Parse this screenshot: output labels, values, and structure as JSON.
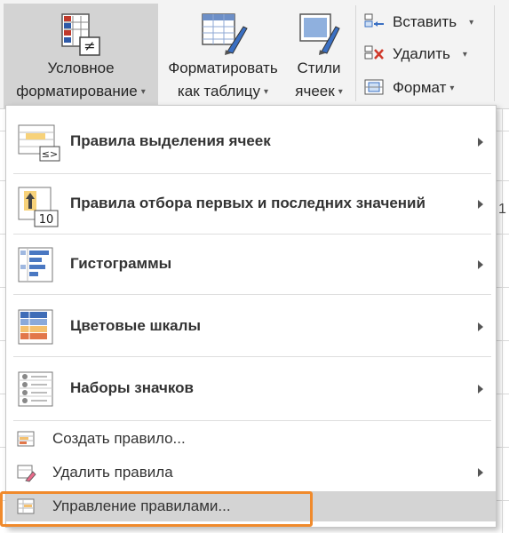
{
  "ribbon": {
    "conditional_formatting": {
      "line1": "Условное",
      "line2": "форматирование"
    },
    "format_as_table": {
      "line1": "Форматировать",
      "line2": "как таблицу"
    },
    "cell_styles": {
      "line1": "Стили",
      "line2": "ячеек"
    },
    "cells_group": {
      "insert": "Вставить",
      "delete": "Удалить",
      "format": "Формат"
    }
  },
  "menu": {
    "big_items": [
      {
        "label": "Правила выделения ячеек",
        "icon": "highlight-cells-rules-icon",
        "has_submenu": true
      },
      {
        "label": "Правила отбора первых и последних значений",
        "icon": "top-bottom-rules-icon",
        "has_submenu": true
      },
      {
        "label": "Гистограммы",
        "icon": "data-bars-icon",
        "has_submenu": true
      },
      {
        "label": "Цветовые шкалы",
        "icon": "color-scales-icon",
        "has_submenu": true
      },
      {
        "label": "Наборы значков",
        "icon": "icon-sets-icon",
        "has_submenu": true
      }
    ],
    "small_items": [
      {
        "label": "Создать правило...",
        "icon": "new-rule-icon",
        "has_submenu": false
      },
      {
        "label": "Удалить правила",
        "icon": "clear-rules-icon",
        "has_submenu": true
      },
      {
        "label": "Управление правилами...",
        "icon": "manage-rules-icon",
        "has_submenu": false
      }
    ],
    "highlight_color": "#f08a2c"
  },
  "sheet": {
    "visible_fragment": "1"
  }
}
